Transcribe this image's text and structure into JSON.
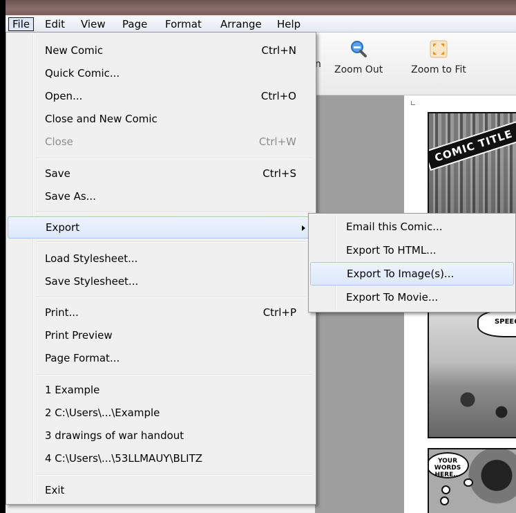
{
  "menubar": {
    "items": [
      "File",
      "Edit",
      "View",
      "Page",
      "Format",
      "Arrange",
      "Help"
    ]
  },
  "toolbar": {
    "zoom_out": {
      "label": "Zoom Out",
      "icon": "zoom-out-icon"
    },
    "zoom_to_fit": {
      "label": "Zoom to Fit",
      "icon": "zoom-to-fit-icon"
    },
    "partial_label": "n"
  },
  "file_menu": {
    "groups": [
      [
        {
          "label": "New Comic",
          "shortcut": "Ctrl+N"
        },
        {
          "label": "Quick Comic...",
          "shortcut": ""
        },
        {
          "label": "Open...",
          "shortcut": "Ctrl+O"
        },
        {
          "label": "Close and New Comic",
          "shortcut": ""
        },
        {
          "label": "Close",
          "shortcut": "Ctrl+W",
          "disabled": true
        }
      ],
      [
        {
          "label": "Save",
          "shortcut": "Ctrl+S"
        },
        {
          "label": "Save As...",
          "shortcut": ""
        }
      ],
      [
        {
          "label": "Export",
          "shortcut": "",
          "submenu": true,
          "highlighted": true
        }
      ],
      [
        {
          "label": "Load Stylesheet...",
          "shortcut": ""
        },
        {
          "label": "Save Stylesheet...",
          "shortcut": ""
        }
      ],
      [
        {
          "label": "Print...",
          "shortcut": "Ctrl+P"
        },
        {
          "label": "Print Preview",
          "shortcut": ""
        },
        {
          "label": "Page Format...",
          "shortcut": ""
        }
      ],
      [
        {
          "label": "1 Example",
          "shortcut": ""
        },
        {
          "label": "2 C:\\Users\\...\\Example",
          "shortcut": ""
        },
        {
          "label": "3 drawings of war handout",
          "shortcut": ""
        },
        {
          "label": "4 C:\\Users\\...\\53LLMAUY\\BLITZ",
          "shortcut": ""
        }
      ],
      [
        {
          "label": "Exit",
          "shortcut": ""
        }
      ]
    ]
  },
  "export_submenu": {
    "items": [
      {
        "label": "Email this Comic...",
        "highlighted": false
      },
      {
        "label": "Export To HTML...",
        "highlighted": false
      },
      {
        "label": "Export To Image(s)...",
        "highlighted": true
      },
      {
        "label": "Export To Movie...",
        "highlighted": false
      }
    ]
  },
  "comic": {
    "title": "COMIC TITLE",
    "speech_bubble": "SPEECH",
    "words_bubble": "YOUR WORDS HERE..."
  },
  "colors": {
    "menu_highlight": "#dce8fa",
    "menu_highlight_border": "#a9c6ee",
    "disabled_text": "#8d8d8d",
    "workspace": "#9e9e9e"
  }
}
